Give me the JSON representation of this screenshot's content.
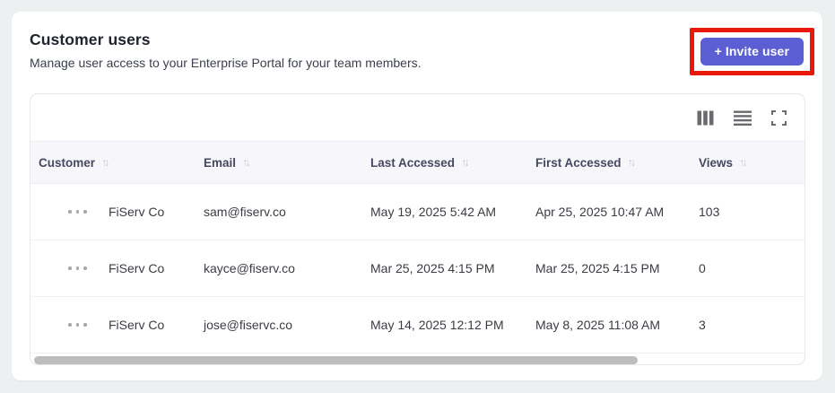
{
  "card": {
    "title": "Customer users",
    "subtitle": "Manage user access to your Enterprise Portal for your team members.",
    "invite_button": {
      "label": "+ Invite user",
      "color": "#5b5fd3",
      "annotation_color": "#e8190a"
    }
  },
  "toolbar": {
    "icons": [
      {
        "name": "columns-icon"
      },
      {
        "name": "rows-icon"
      },
      {
        "name": "fullscreen-icon"
      }
    ]
  },
  "table": {
    "sort_glyph": "↑↓",
    "header_bg": "#f7f7fb",
    "columns": [
      {
        "label": "Customer"
      },
      {
        "label": "Email"
      },
      {
        "label": "Last Accessed"
      },
      {
        "label": "First Accessed"
      },
      {
        "label": "Views"
      }
    ],
    "rows": [
      {
        "customer": "FiServ Co",
        "email": "sam@fiserv.co",
        "last_accessed": "May 19, 2025 5:42 AM",
        "first_accessed": "Apr 25, 2025 10:47 AM",
        "views": "103"
      },
      {
        "customer": "FiServ Co",
        "email": "kayce@fiserv.co",
        "last_accessed": "Mar 25, 2025 4:15 PM",
        "first_accessed": "Mar 25, 2025 4:15 PM",
        "views": "0"
      },
      {
        "customer": "FiServ Co",
        "email": "jose@fiservc.co",
        "last_accessed": "May 14, 2025 12:12 PM",
        "first_accessed": "May 8, 2025 11:08 AM",
        "views": "3"
      }
    ]
  }
}
